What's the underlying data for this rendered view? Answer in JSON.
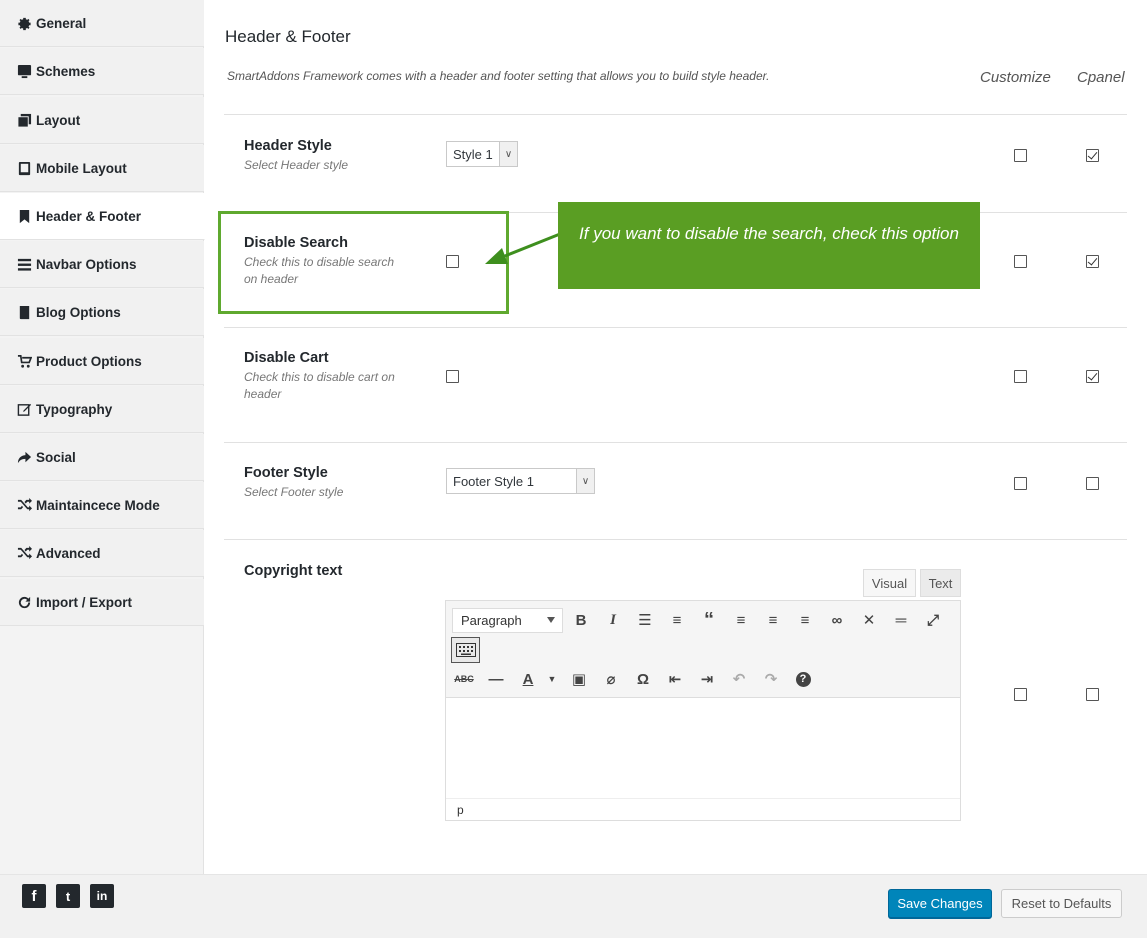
{
  "sidebar": {
    "items": [
      {
        "label": "General",
        "icon": "gear-icon"
      },
      {
        "label": "Schemes",
        "icon": "monitor-icon"
      },
      {
        "label": "Layout",
        "icon": "copy-icon"
      },
      {
        "label": "Mobile Layout",
        "icon": "tablet-icon"
      },
      {
        "label": "Header & Footer",
        "icon": "bookmark-icon",
        "active": true
      },
      {
        "label": "Navbar Options",
        "icon": "bars-icon"
      },
      {
        "label": "Blog Options",
        "icon": "book-icon"
      },
      {
        "label": "Product Options",
        "icon": "cart-icon"
      },
      {
        "label": "Typography",
        "icon": "edit-icon"
      },
      {
        "label": "Social",
        "icon": "share-icon"
      },
      {
        "label": "Maintaincece Mode",
        "icon": "shuffle-icon"
      },
      {
        "label": "Advanced",
        "icon": "shuffle-icon"
      },
      {
        "label": "Import / Export",
        "icon": "refresh-icon"
      }
    ]
  },
  "main": {
    "title": "Header & Footer",
    "description": "SmartAddons Framework comes with a header and footer setting that allows you to build style header.",
    "col_customize": "Customize",
    "col_cpanel": "Cpanel",
    "rows": {
      "header_style": {
        "title": "Header Style",
        "subtitle": "Select Header style",
        "value": "Style 1",
        "customize": false,
        "cpanel": true
      },
      "disable_search": {
        "title": "Disable Search",
        "subtitle": "Check this to disable search on header",
        "checked": false,
        "customize": false,
        "cpanel": true
      },
      "disable_cart": {
        "title": "Disable Cart",
        "subtitle": "Check this to disable cart on header",
        "checked": false,
        "customize": false,
        "cpanel": true
      },
      "footer_style": {
        "title": "Footer Style",
        "subtitle": "Select Footer style",
        "value": "Footer Style 1",
        "customize": false,
        "cpanel": false
      },
      "copyright": {
        "title": "Copyright text",
        "customize": false,
        "cpanel": false
      }
    },
    "callout": "If you want to disable the search, check this option"
  },
  "editor": {
    "tab_visual": "Visual",
    "tab_text": "Text",
    "format": "Paragraph",
    "status_path": "p"
  },
  "footer": {
    "save_label": "Save Changes",
    "reset_label": "Reset to Defaults",
    "social": [
      {
        "icon": "facebook-icon",
        "glyph": "f"
      },
      {
        "icon": "twitter-icon",
        "glyph": "t"
      },
      {
        "icon": "linkedin-icon",
        "glyph": "in"
      }
    ]
  },
  "colors": {
    "accent": "#0085ba",
    "callout": "#5a9e23",
    "highlight": "#5fa92f"
  }
}
